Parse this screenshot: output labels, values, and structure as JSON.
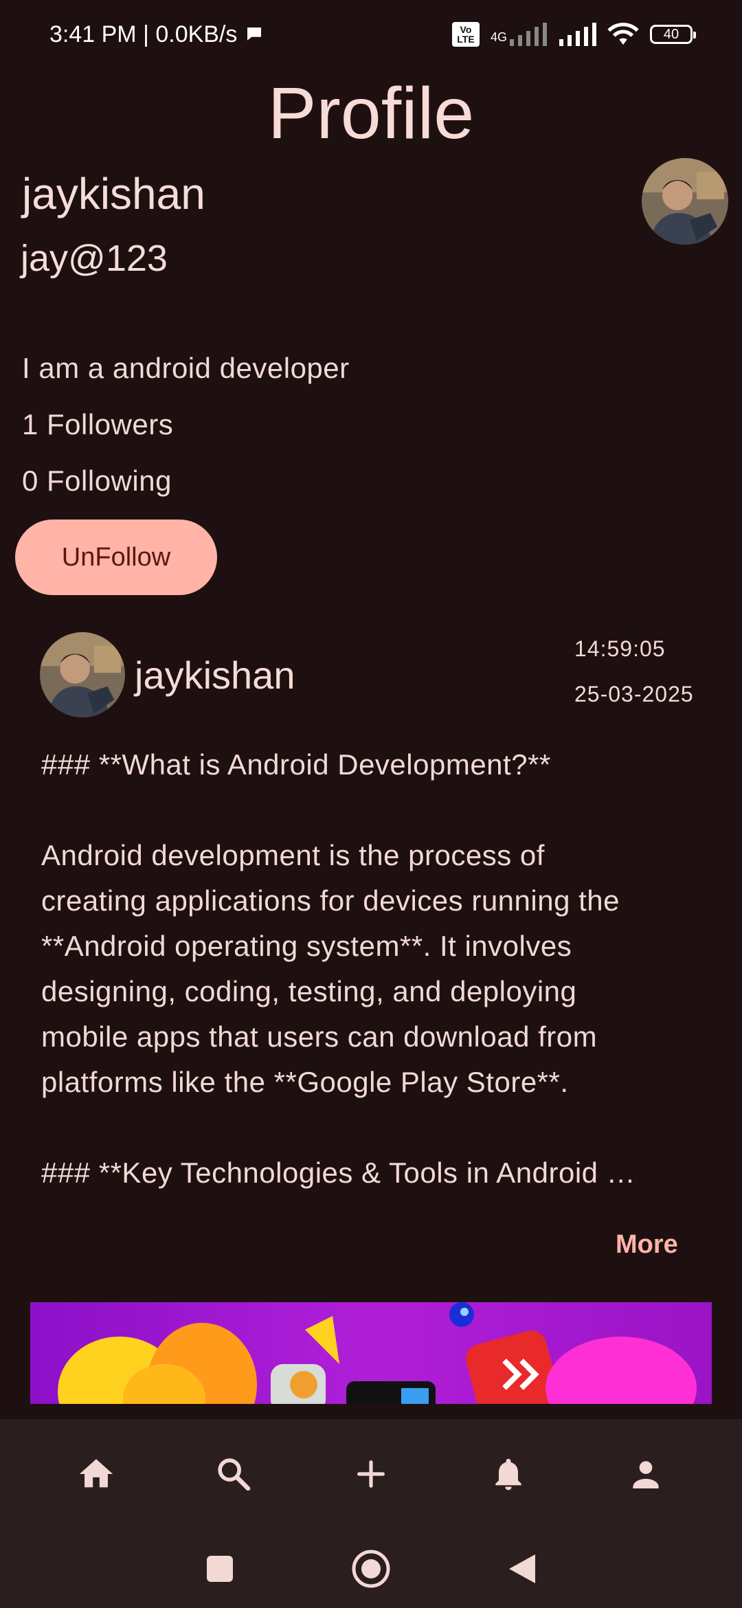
{
  "status_bar": {
    "time": "3:41 PM | 0.0KB/s",
    "volte": "Vo LTE",
    "network": "4G",
    "battery": "40"
  },
  "page": {
    "title": "Profile"
  },
  "profile": {
    "name": "jaykishan",
    "username": "jay@123",
    "bio": "I am a android developer",
    "followers": "1 Followers",
    "following": "0 Following",
    "action_button": "UnFollow"
  },
  "post": {
    "author": "jaykishan",
    "time": "14:59:05",
    "date": "25-03-2025",
    "lines": [
      "### **What is Android Development?**",
      "",
      "Android development is the process of",
      "creating applications for devices running the",
      "**Android operating system**. It involves",
      "designing, coding, testing, and deploying",
      "mobile apps that users can download from",
      "platforms like the **Google Play Store**.",
      "",
      "### **Key Technologies & Tools in Android …"
    ],
    "more_label": "More"
  },
  "bottom_nav": {
    "items": [
      {
        "icon": "home-icon"
      },
      {
        "icon": "search-icon"
      },
      {
        "icon": "add-icon"
      },
      {
        "icon": "notifications-icon"
      },
      {
        "icon": "profile-icon"
      }
    ]
  },
  "system_nav": {
    "items": [
      {
        "icon": "recents-icon"
      },
      {
        "icon": "home-circle-icon"
      },
      {
        "icon": "back-icon"
      }
    ]
  },
  "colors": {
    "background": "#1e1010",
    "accent": "#ffb4a7",
    "nav_background": "#2a1e1e"
  }
}
